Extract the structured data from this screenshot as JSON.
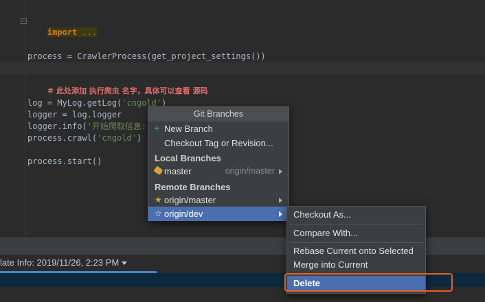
{
  "editor": {
    "line_import_kw": "import",
    "line_import_dots": " ...",
    "line_process_a": "process = CrawlerProcess(get_project_settings())",
    "line_comment": "# 此处添加 执行爬虫 名字，具体可以查看 源码",
    "line_log_a": "log = MyLog.getLog(",
    "line_log_str": "'cngold'",
    "line_log_b": ")",
    "line_logger": "logger = log.logger",
    "line_info_a": "logger.info(",
    "line_info_str": "'开始爬取信息:",
    "line_crawl_a": "process.crawl(",
    "line_crawl_str": "'cngold'",
    "line_crawl_b": ")",
    "line_start": "process.start()"
  },
  "tool_window": {
    "update_info": "late Info: 2019/11/26, 2:23 PM"
  },
  "git_popup": {
    "title": "Git Branches",
    "new_branch": "New Branch",
    "checkout_tag": "Checkout Tag or Revision...",
    "local_header": "Local Branches",
    "local_items": [
      {
        "name": "master",
        "tracking": "origin/master"
      }
    ],
    "remote_header": "Remote Branches",
    "remote_items": [
      {
        "name": "origin/master"
      },
      {
        "name": "origin/dev"
      }
    ]
  },
  "branch_submenu": {
    "items": [
      "Checkout As...",
      "Compare With...",
      "Rebase Current onto Selected",
      "Merge into Current",
      "Delete"
    ]
  },
  "colors": {
    "selection": "#4b6eaf",
    "highlight_outline": "#e0602a",
    "comment": "#e06c6c",
    "string": "#6a8759"
  },
  "icons": {
    "new_branch": "plus-icon",
    "local_branch": "tag-icon",
    "remote_branch": "star-icon",
    "remote_branch_selected": "star-outline-icon"
  }
}
